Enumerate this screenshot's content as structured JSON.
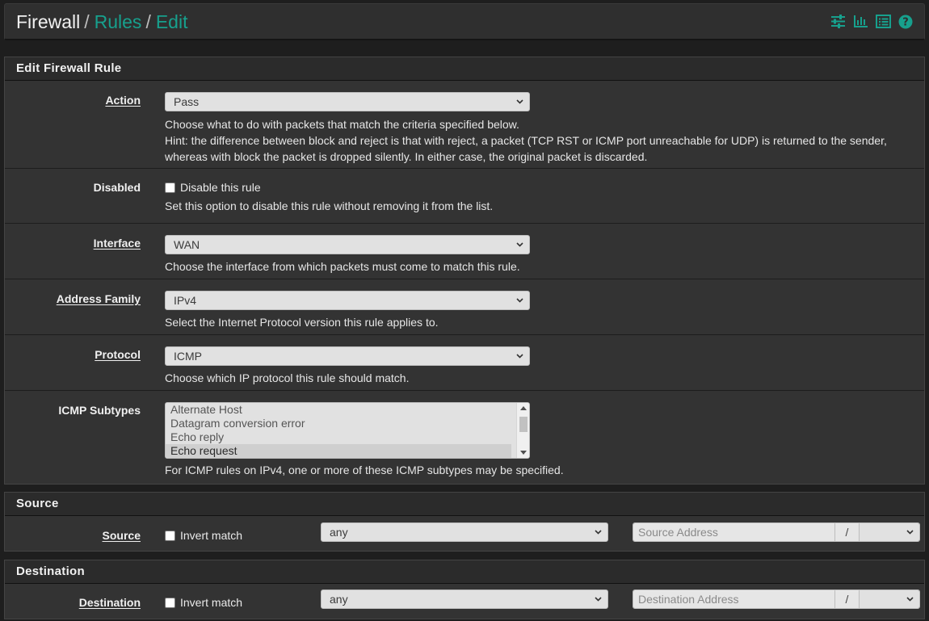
{
  "breadcrumb": {
    "home": "Firewall",
    "separator": "/",
    "rules": "Rules",
    "edit": "Edit"
  },
  "toolbar_icons": [
    "sliders-icon",
    "bar-chart-icon",
    "list-icon",
    "help-icon"
  ],
  "accent_color": "#17a08d",
  "edit_panel": {
    "title": "Edit Firewall Rule",
    "action": {
      "label": "Action",
      "value": "Pass",
      "help1": "Choose what to do with packets that match the criteria specified below.",
      "help2": "Hint: the difference between block and reject is that with reject, a packet (TCP RST or ICMP port unreachable for UDP) is returned to the sender,",
      "help3": "whereas with block the packet is dropped silently. In either case, the original packet is discarded."
    },
    "disabled": {
      "label": "Disabled",
      "checkbox_label": "Disable this rule",
      "help": "Set this option to disable this rule without removing it from the list."
    },
    "interface": {
      "label": "Interface",
      "value": "WAN",
      "help": "Choose the interface from which packets must come to match this rule."
    },
    "address_family": {
      "label": "Address Family",
      "value": "IPv4",
      "help": "Select the Internet Protocol version this rule applies to."
    },
    "protocol": {
      "label": "Protocol",
      "value": "ICMP",
      "help": "Choose which IP protocol this rule should match."
    },
    "icmp_subtypes": {
      "label": "ICMP Subtypes",
      "options": [
        "Alternate Host",
        "Datagram conversion error",
        "Echo reply",
        "Echo request"
      ],
      "selected": "Echo request",
      "help": "For ICMP rules on IPv4, one or more of these ICMP subtypes may be specified."
    }
  },
  "source_panel": {
    "title": "Source",
    "label": "Source",
    "invert_label": "Invert match",
    "type_value": "any",
    "address_placeholder": "Source Address",
    "slash": "/"
  },
  "destination_panel": {
    "title": "Destination",
    "label": "Destination",
    "invert_label": "Invert match",
    "type_value": "any",
    "address_placeholder": "Destination Address",
    "slash": "/"
  }
}
